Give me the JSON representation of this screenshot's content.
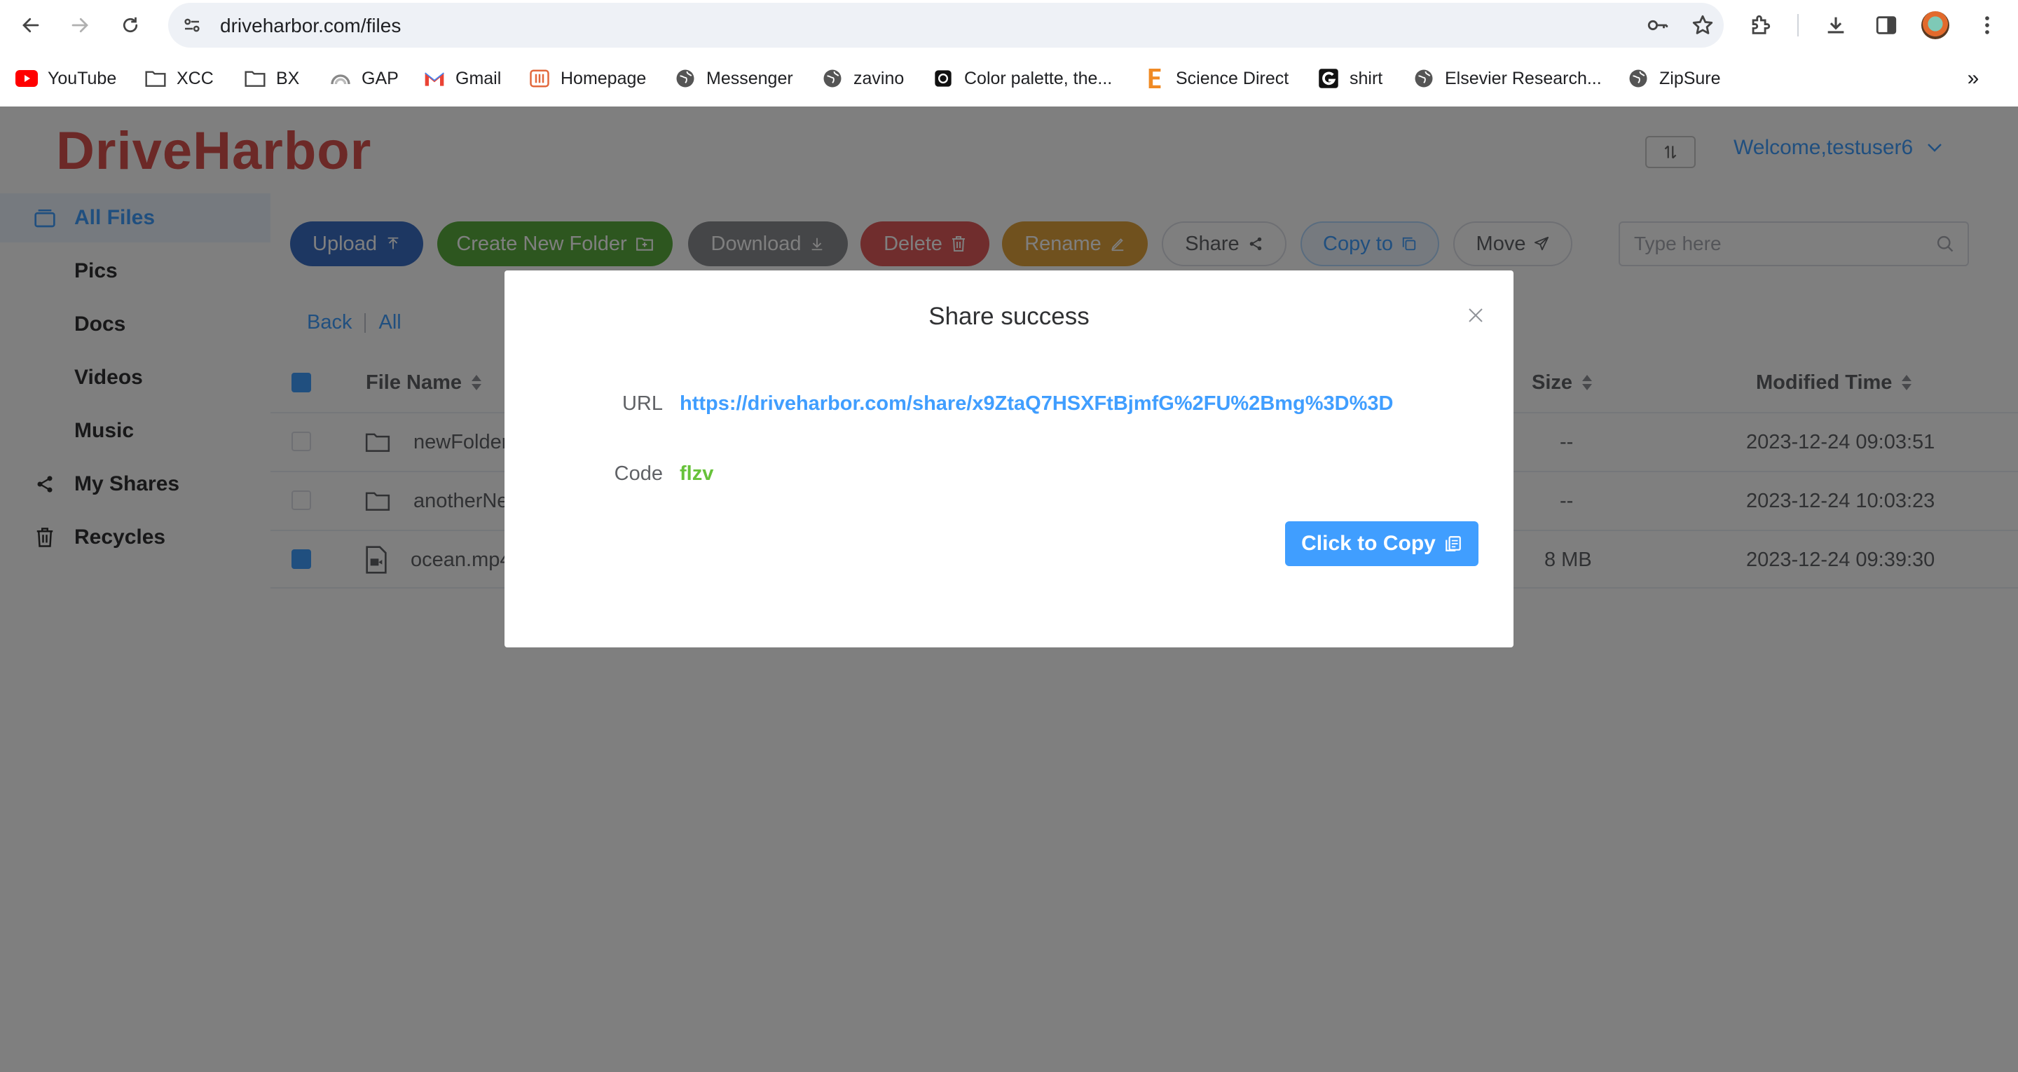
{
  "browser": {
    "url": "driveharbor.com/files",
    "bookmarks": [
      {
        "label": "YouTube",
        "icon": "youtube-icon"
      },
      {
        "label": "XCC",
        "icon": "folder-icon"
      },
      {
        "label": "BX",
        "icon": "folder-icon"
      },
      {
        "label": "GAP",
        "icon": "gap-icon"
      },
      {
        "label": "Gmail",
        "icon": "gmail-icon"
      },
      {
        "label": "Homepage",
        "icon": "homepage-icon"
      },
      {
        "label": "Messenger",
        "icon": "globe-icon"
      },
      {
        "label": "zavino",
        "icon": "globe-icon"
      },
      {
        "label": "Color palette, the...",
        "icon": "palette-icon"
      },
      {
        "label": "Science Direct",
        "icon": "elsevier-icon"
      },
      {
        "label": "shirt",
        "icon": "shirt-g-icon"
      },
      {
        "label": "Elsevier Research...",
        "icon": "globe-icon"
      },
      {
        "label": "ZipSure",
        "icon": "globe-icon"
      }
    ]
  },
  "app": {
    "logo": "DriveHarbor",
    "welcome": "Welcome,testuser6",
    "sidebar": [
      {
        "label": "All Files",
        "icon": "files-icon",
        "active": true
      },
      {
        "label": "Pics"
      },
      {
        "label": "Docs"
      },
      {
        "label": "Videos"
      },
      {
        "label": "Music"
      },
      {
        "label": "My Shares",
        "icon": "share-icon"
      },
      {
        "label": "Recycles",
        "icon": "trash-icon"
      }
    ],
    "toolbar": {
      "upload": "Upload",
      "create_folder": "Create New Folder",
      "download": "Download",
      "delete": "Delete",
      "rename": "Rename",
      "share": "Share",
      "copy_to": "Copy to",
      "move": "Move",
      "search_placeholder": "Type here"
    },
    "colors": {
      "upload": "#3a6fc4",
      "create_folder": "#5bad3f",
      "download": "#8a8c90",
      "delete": "#e05a5a",
      "rename": "#e0a23c",
      "accent": "#409eff"
    },
    "breadcrumb": {
      "back": "Back",
      "all": "All"
    },
    "table": {
      "headers": {
        "name": "File Name",
        "size": "Size",
        "modified": "Modified Time"
      },
      "rows": [
        {
          "name": "newFolder",
          "size": "--",
          "modified": "2023-12-24 09:03:51",
          "type": "folder",
          "checked": false
        },
        {
          "name": "anotherNe",
          "size": "--",
          "modified": "2023-12-24 10:03:23",
          "type": "folder",
          "checked": false
        },
        {
          "name": "ocean.mp4",
          "size": "8 MB",
          "modified": "2023-12-24 09:39:30",
          "type": "video",
          "checked": true
        }
      ]
    }
  },
  "dialog": {
    "title": "Share success",
    "url_label": "URL",
    "url": "https://driveharbor.com/share/x9ZtaQ7HSXFtBjmfG%2FU%2Bmg%3D%3D",
    "code_label": "Code",
    "code": "flzv",
    "copy_button": "Click to Copy"
  }
}
